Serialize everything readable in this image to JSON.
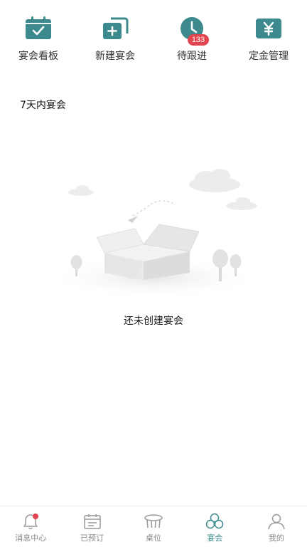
{
  "quick_actions": [
    {
      "label": "宴会看板",
      "icon": "calendar-check-icon"
    },
    {
      "label": "新建宴会",
      "icon": "add-copy-icon"
    },
    {
      "label": "待跟进",
      "icon": "clock-icon",
      "badge": "133"
    },
    {
      "label": "定金管理",
      "icon": "yen-icon"
    }
  ],
  "section": {
    "title": "7天内宴会"
  },
  "empty_state": {
    "text": "还未创建宴会"
  },
  "tabbar": {
    "items": [
      {
        "label": "消息中心",
        "icon": "bell-icon",
        "has_dot": true
      },
      {
        "label": "已预订",
        "icon": "calendar-icon"
      },
      {
        "label": "桌位",
        "icon": "table-icon"
      },
      {
        "label": "宴会",
        "icon": "banquet-icon",
        "active": true
      },
      {
        "label": "我的",
        "icon": "user-icon"
      }
    ]
  },
  "colors": {
    "accent": "#3d8a8e",
    "badge": "#e2454f",
    "inactive": "#888888"
  }
}
